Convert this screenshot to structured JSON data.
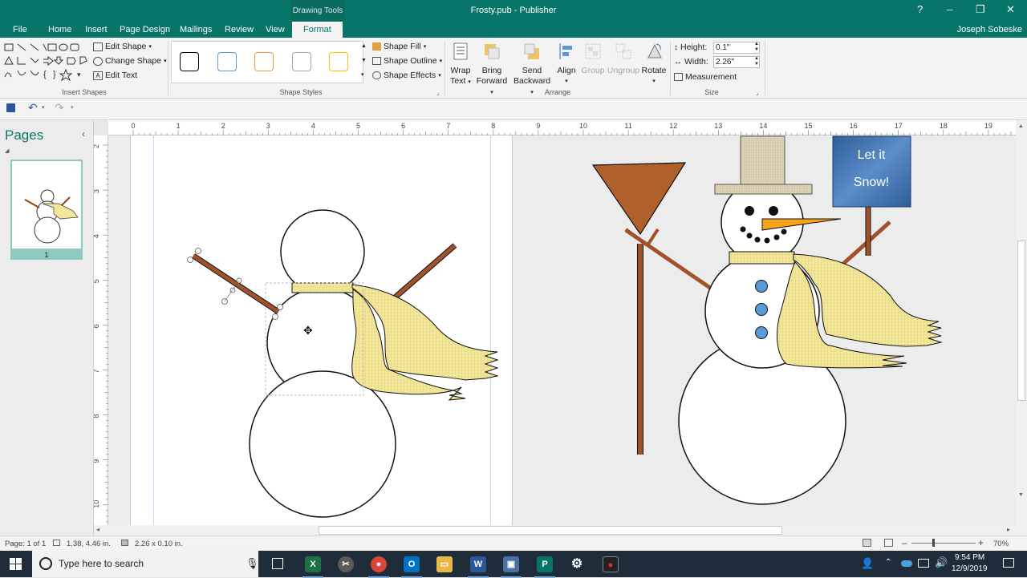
{
  "window": {
    "context_tab_group": "Drawing Tools",
    "title": "Frosty.pub - Publisher",
    "user": "Joseph Sobeske"
  },
  "tabs": [
    "File",
    "Home",
    "Insert",
    "Page Design",
    "Mailings",
    "Review",
    "View",
    "Format"
  ],
  "ribbon": {
    "insert_shapes": {
      "edit_shape": "Edit Shape",
      "change_shape": "Change Shape",
      "edit_text": "Edit Text",
      "label": "Insert Shapes"
    },
    "shape_styles": {
      "label": "Shape Styles",
      "shape_fill": "Shape Fill",
      "shape_outline": "Shape Outline",
      "shape_effects": "Shape Effects",
      "swatch_colors": [
        "#000000",
        "#5b9bd5",
        "#ed9a3a",
        "#a5a5a5",
        "#ffc000"
      ]
    },
    "arrange": {
      "label": "Arrange",
      "wrap_text": [
        "Wrap",
        "Text"
      ],
      "bring_forward": [
        "Bring",
        "Forward"
      ],
      "send_backward": [
        "Send",
        "Backward"
      ],
      "align": "Align",
      "group": "Group",
      "ungroup": "Ungroup",
      "rotate": "Rotate"
    },
    "size": {
      "label": "Size",
      "height_label": "Height:",
      "height_value": "0.1\"",
      "width_label": "Width:",
      "width_value": "2.26\"",
      "measurement": "Measurement"
    }
  },
  "pages_pane": {
    "title": "Pages",
    "page_number": "1"
  },
  "ruler": {
    "horizontal_labels": [
      "0",
      "1",
      "2",
      "3",
      "4",
      "5",
      "6",
      "7",
      "8",
      "9",
      "10",
      "11",
      "12",
      "13",
      "14",
      "15",
      "16",
      "17",
      "18",
      "19"
    ],
    "vertical_labels": [
      "2",
      "3",
      "4",
      "5",
      "6",
      "7",
      "8",
      "9",
      "10"
    ]
  },
  "canvas": {
    "sign_text_line1": "Let it",
    "sign_text_line2": "Snow!",
    "colors": {
      "stick": "#a0522d",
      "scarf": "#f2e79a",
      "broom_head": "#b0602a",
      "carrot": "#f5a31a",
      "button": "#5b9bd5",
      "sign": "#3c6ea8",
      "hat": "#ddd3b8"
    }
  },
  "status": {
    "page": "Page: 1 of 1",
    "position": "1.38, 4.46 in.",
    "size": "2.26 x 0.10 in.",
    "zoom": "70%"
  },
  "taskbar": {
    "search_placeholder": "Type here to search",
    "time": "9:54 PM",
    "date": "12/9/2019"
  }
}
